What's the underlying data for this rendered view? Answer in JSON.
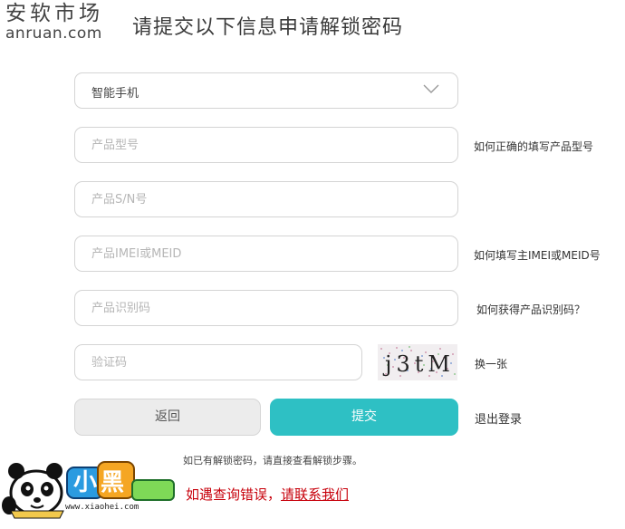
{
  "watermark": {
    "cn": "安软市场",
    "en": "anruan.com"
  },
  "page_title": "请提交以下信息申请解锁密码",
  "device_select": {
    "value": "智能手机"
  },
  "fields": {
    "model": {
      "placeholder": "产品型号",
      "help": "如何正确的填写产品型号"
    },
    "sn": {
      "placeholder": "产品S/N号"
    },
    "imei": {
      "placeholder": "产品IMEI或MEID",
      "help": "如何填写主IMEI或MEID号"
    },
    "idcode": {
      "placeholder": "产品识别码",
      "help": "如何获得产品识别码？"
    },
    "captcha": {
      "placeholder": "验证码",
      "refresh": "换一张",
      "image_text": "j3tM"
    }
  },
  "buttons": {
    "back": "返回",
    "submit": "提交",
    "logout": "退出登录"
  },
  "note": "如已有解锁密码，请直接查看解锁步骤。",
  "error": {
    "prefix": "如遇查询错误，",
    "link": "请联系我们"
  },
  "mascot": {
    "brand": "小黑游戏",
    "url": "www.xiaohei.com"
  },
  "colors": {
    "accent": "#2ec0c4",
    "error": "#c7000b"
  }
}
